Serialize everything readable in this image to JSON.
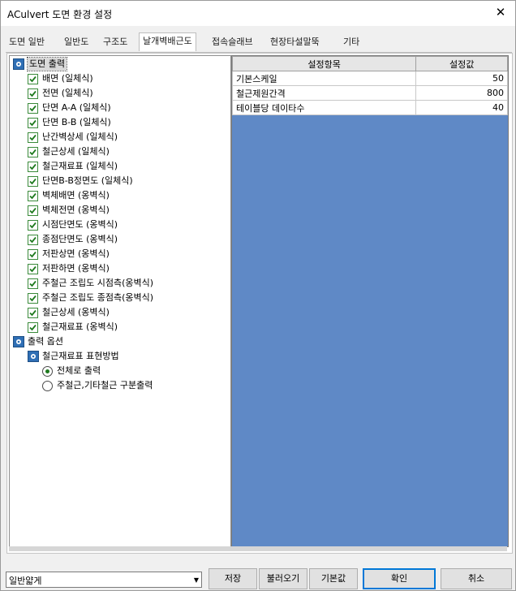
{
  "window": {
    "title": "ACulvert 도면 환경 설정",
    "close_label": "✕"
  },
  "tabs": [
    {
      "label": "도면 일반"
    },
    {
      "label": "일반도"
    },
    {
      "label": "구조도"
    },
    {
      "label": "날개벽배근도"
    },
    {
      "label": "접속슬래브"
    },
    {
      "label": "현장타설말뚝"
    },
    {
      "label": "기타"
    }
  ],
  "tree": {
    "group1": "도면 출력",
    "items": [
      "배면 (일체식)",
      "전면 (일체식)",
      "단면 A-A (일체식)",
      "단면 B-B (일체식)",
      "난간벽상세 (일체식)",
      "철근상세 (일체식)",
      "철근재료표 (일체식)",
      "단면B-B정면도 (일체식)",
      "벽체배면 (옹벽식)",
      "벽체전면 (옹벽식)",
      "시점단면도 (옹벽식)",
      "종점단면도 (옹벽식)",
      "저판상면 (옹벽식)",
      "저판하면 (옹벽식)",
      "주철근 조립도 시점측(옹벽식)",
      "주철근 조립도 종점측(옹벽식)",
      "철근상세 (옹벽식)",
      "철근재료표 (옹벽식)"
    ],
    "group2": "출력 옵션",
    "subgroup": "철근재료표 표현방법",
    "radios": [
      "전체로 출력",
      "주철근,기타철근 구분출력"
    ]
  },
  "grid": {
    "headers": [
      "설정항목",
      "설정값"
    ],
    "rows": [
      {
        "name": "기본스케일",
        "value": "50"
      },
      {
        "name": "철근제원간격",
        "value": "800"
      },
      {
        "name": "테이블당 데이타수",
        "value": "40"
      }
    ]
  },
  "footer": {
    "combo_value": "일반얇게",
    "save": "저장",
    "load": "불러오기",
    "default": "기본값",
    "ok": "확인",
    "cancel": "취소"
  },
  "colors": {
    "grid_background": "#5f89c6",
    "check": "#2e8b2e",
    "tab_active": "#ffffff"
  }
}
